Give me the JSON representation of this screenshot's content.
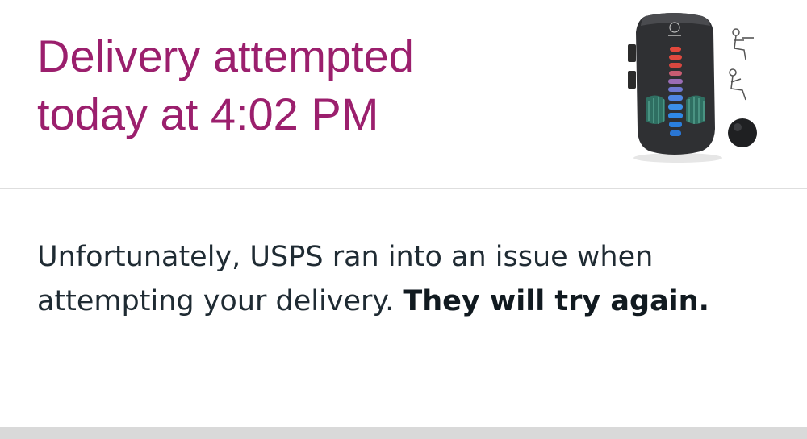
{
  "shipment": {
    "status_line_1": "Delivery attempted",
    "status_line_2": "today at 4:02 PM",
    "product_image": "lumbar-support-pillow-image",
    "message_text": "Unfortunately, USPS ran into an issue when attempting your delivery.",
    "message_emphasis": "They will try again."
  },
  "colors": {
    "status_title": "#9b1f6d",
    "message_text": "#1f2b33",
    "divider": "#dedede",
    "footer_bar": "#d9d9d9"
  }
}
